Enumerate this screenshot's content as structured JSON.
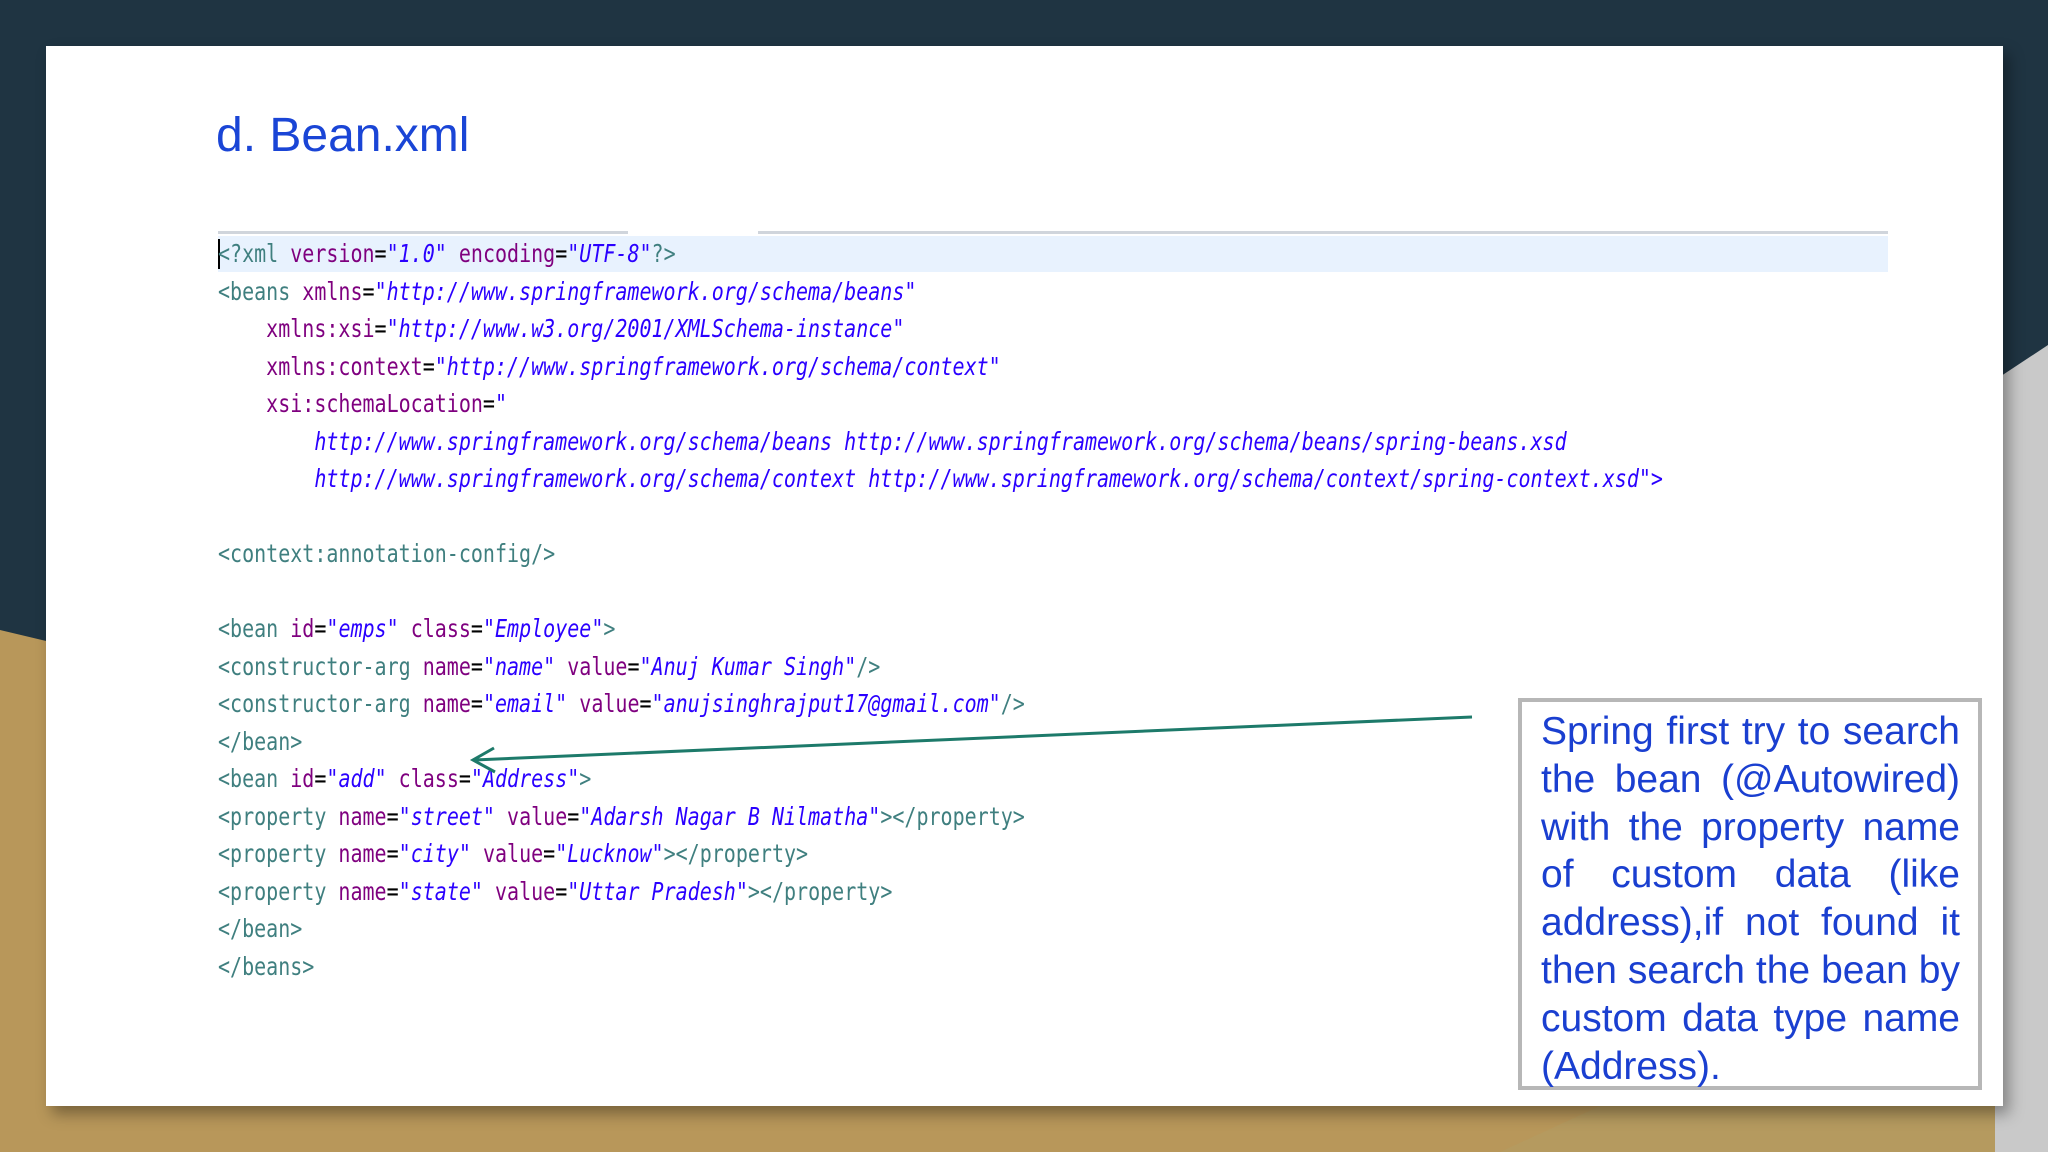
{
  "title": "d. Bean.xml",
  "callout": {
    "text": "Spring first try to search the bean (@Autowired) with the property name of custom data (like address),if not found it then search the bean by custom data type name (Address)."
  },
  "code": {
    "lines": [
      "<?xml version=\"1.0\" encoding=\"UTF-8\"?>",
      "<beans xmlns=\"http://www.springframework.org/schema/beans\"",
      "    xmlns:xsi=\"http://www.w3.org/2001/XMLSchema-instance\"",
      "    xmlns:context=\"http://www.springframework.org/schema/context\"",
      "    xsi:schemaLocation=\"",
      "        http://www.springframework.org/schema/beans http://www.springframework.org/schema/beans/spring-beans.xsd",
      "        http://www.springframework.org/schema/context http://www.springframework.org/schema/context/spring-context.xsd\">",
      "",
      "<context:annotation-config/>",
      "",
      "<bean id=\"emps\" class=\"Employee\">",
      "<constructor-arg name=\"name\" value=\"Anuj Kumar Singh\"/>",
      "<constructor-arg name=\"email\" value=\"anujsinghrajput17@gmail.com\"/>",
      "</bean>",
      "<bean id=\"add\" class=\"Address\">",
      "<property name=\"street\" value=\"Adarsh Nagar B Nilmatha\"></property>",
      "<property name=\"city\" value=\"Lucknow\"></property>",
      "<property name=\"state\" value=\"Uttar Pradesh\"></property>",
      "</bean>",
      "</beans>"
    ]
  },
  "colors": {
    "title": "#1a45d6",
    "callout_text": "#1a3fd0",
    "arrow": "#1d7a6a",
    "tag": "#3f7f7f",
    "attribute": "#7f007f",
    "value": "#2a00ff"
  }
}
